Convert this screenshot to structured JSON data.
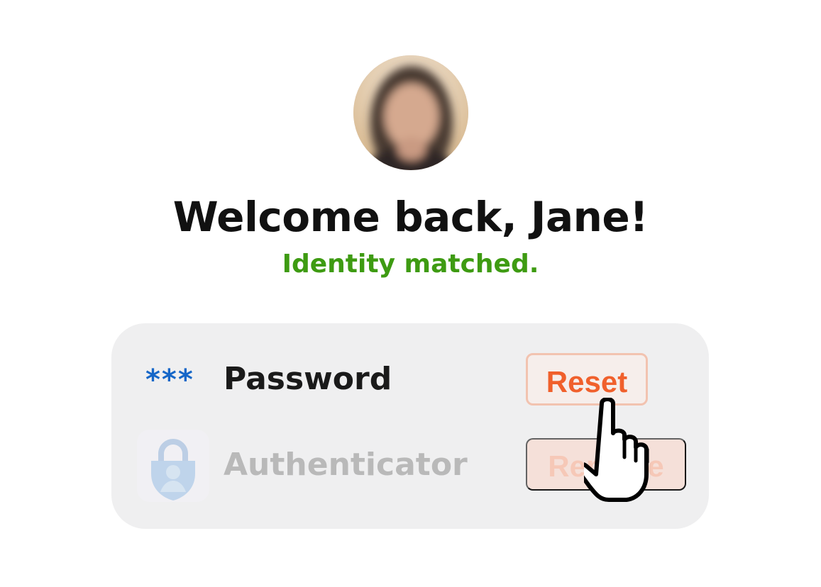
{
  "greeting": {
    "title": "Welcome back, Jane!",
    "status": "Identity matched."
  },
  "methods": [
    {
      "icon": "password-dots-icon",
      "marker": "***",
      "label": "Password",
      "action": "Reset"
    },
    {
      "icon": "authenticator-lock-icon",
      "label": "Authenticator",
      "action": "Remove"
    }
  ],
  "colors": {
    "success": "#3e9b12",
    "accent": "#f0602c",
    "password_marker": "#1667c8"
  }
}
